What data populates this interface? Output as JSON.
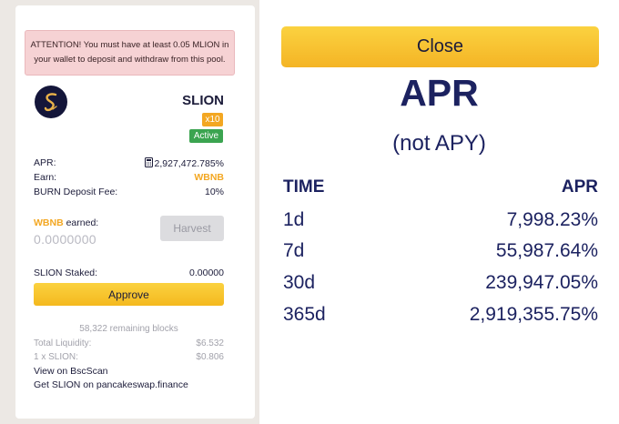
{
  "pool_card": {
    "attention_line1": "ATTENTION! You must have at least 0.05 MLION in",
    "attention_line2": "your wallet to deposit and withdraw from this pool.",
    "logo_icon": "slion-logo-icon",
    "token_name": "SLION",
    "multiplier_badge": "x10",
    "status_badge": "Active",
    "apr_label": "APR:",
    "apr_icon": "calculator-icon",
    "apr_value": "2,927,472.785%",
    "earn_label": "Earn:",
    "earn_value": "WBNB",
    "burn_fee_label": "BURN Deposit Fee:",
    "burn_fee_value": "10%",
    "earned_token": "WBNB",
    "earned_suffix": "earned:",
    "earned_value": "0.0000000",
    "harvest_label": "Harvest",
    "staked_label": "SLION Staked:",
    "staked_value": "0.00000",
    "approve_label": "Approve",
    "remaining_blocks": "58,322 remaining blocks",
    "total_liquidity_label": "Total Liquidity:",
    "total_liquidity_value": "$6.532",
    "price_label": "1 x SLION:",
    "price_value": "$0.806",
    "bscscan_link": "View on BscScan",
    "pancake_link": "Get SLION on pancakeswap.finance"
  },
  "apr_modal": {
    "close_label": "Close",
    "title": "APR",
    "subtitle": "(not APY)",
    "col_time": "TIME",
    "col_apr": "APR",
    "rows": [
      {
        "time": "1d",
        "apr": "7,998.23%"
      },
      {
        "time": "7d",
        "apr": "55,987.64%"
      },
      {
        "time": "30d",
        "apr": "239,947.05%"
      },
      {
        "time": "365d",
        "apr": "2,919,355.75%"
      }
    ]
  },
  "colors": {
    "accent_yellow": "#f4b91e",
    "orange": "#f3a722",
    "active_green": "#3ba450",
    "navy": "#1c2260",
    "attention_bg": "#f6d2d4"
  }
}
